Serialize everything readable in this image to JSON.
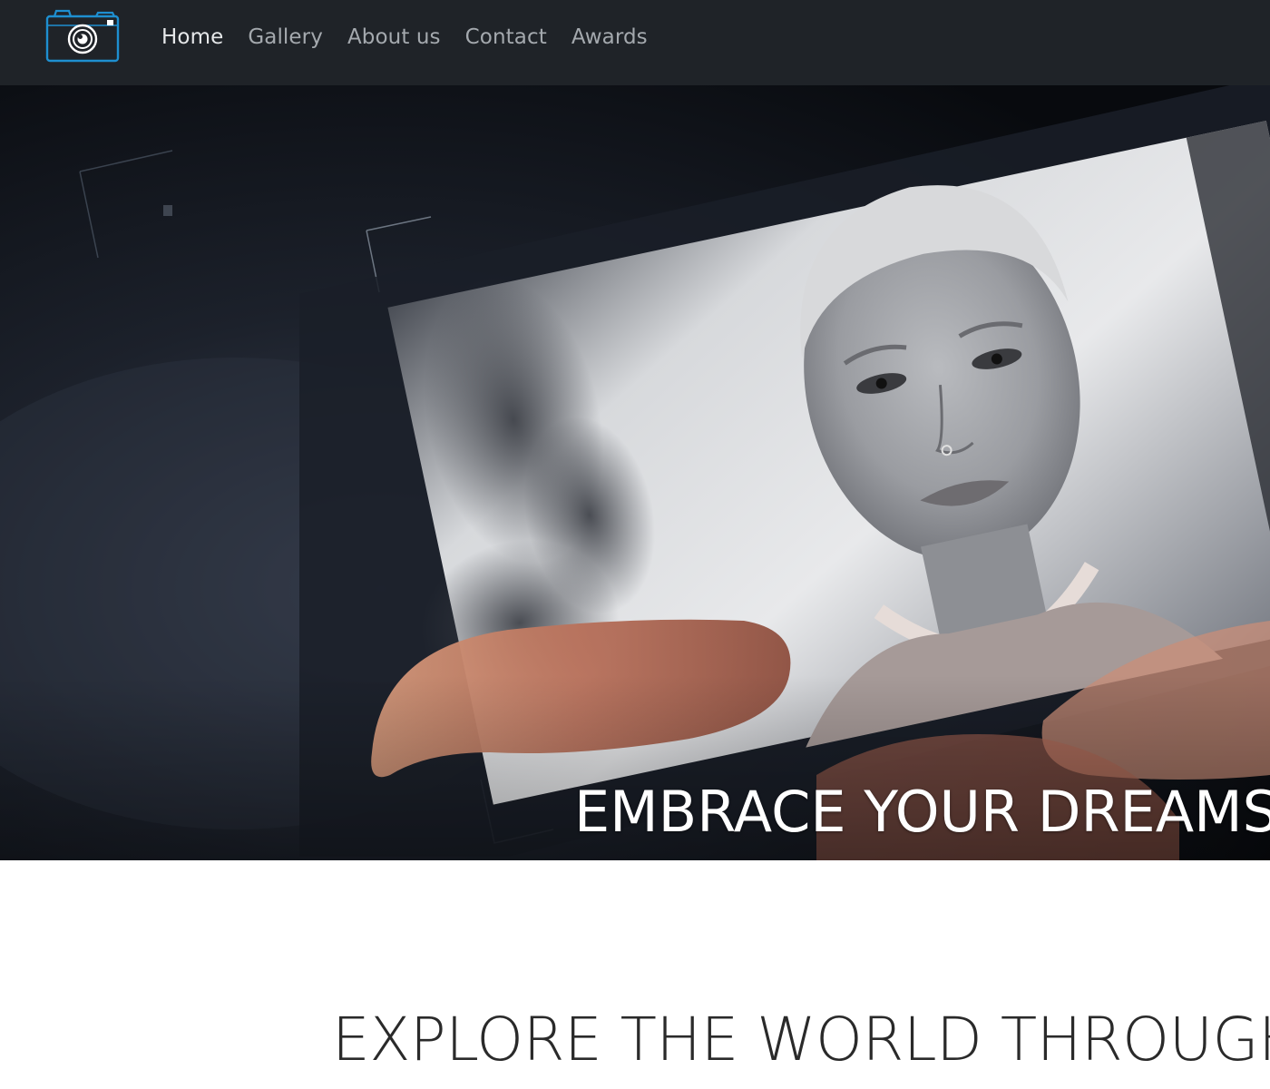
{
  "nav": {
    "logo_icon": "camera-icon",
    "links": [
      {
        "label": "Home",
        "active": true
      },
      {
        "label": "Gallery",
        "active": false
      },
      {
        "label": "About us",
        "active": false
      },
      {
        "label": "Contact",
        "active": false
      },
      {
        "label": "Awards",
        "active": false
      }
    ]
  },
  "hero": {
    "caption": "EMBRACE YOUR DREAMS"
  },
  "section": {
    "heading": "EXPLORE THE WORLD THROUGH MY LENS"
  },
  "colors": {
    "navbar_bg": "#1f2328",
    "logo_blue": "#1e8fd0",
    "nav_text": "#a4a9ae",
    "nav_active": "#e6e8ea",
    "heading_text": "#2a2a2a"
  }
}
